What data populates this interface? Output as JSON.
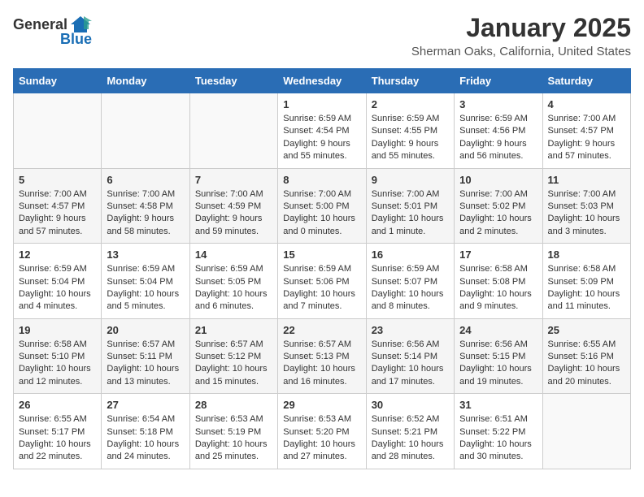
{
  "logo": {
    "general": "General",
    "blue": "Blue"
  },
  "header": {
    "title": "January 2025",
    "subtitle": "Sherman Oaks, California, United States"
  },
  "days_of_week": [
    "Sunday",
    "Monday",
    "Tuesday",
    "Wednesday",
    "Thursday",
    "Friday",
    "Saturday"
  ],
  "weeks": [
    [
      {
        "day": "",
        "sunrise": "",
        "sunset": "",
        "daylight": ""
      },
      {
        "day": "",
        "sunrise": "",
        "sunset": "",
        "daylight": ""
      },
      {
        "day": "",
        "sunrise": "",
        "sunset": "",
        "daylight": ""
      },
      {
        "day": "1",
        "sunrise": "Sunrise: 6:59 AM",
        "sunset": "Sunset: 4:54 PM",
        "daylight": "Daylight: 9 hours and 55 minutes."
      },
      {
        "day": "2",
        "sunrise": "Sunrise: 6:59 AM",
        "sunset": "Sunset: 4:55 PM",
        "daylight": "Daylight: 9 hours and 55 minutes."
      },
      {
        "day": "3",
        "sunrise": "Sunrise: 6:59 AM",
        "sunset": "Sunset: 4:56 PM",
        "daylight": "Daylight: 9 hours and 56 minutes."
      },
      {
        "day": "4",
        "sunrise": "Sunrise: 7:00 AM",
        "sunset": "Sunset: 4:57 PM",
        "daylight": "Daylight: 9 hours and 57 minutes."
      }
    ],
    [
      {
        "day": "5",
        "sunrise": "Sunrise: 7:00 AM",
        "sunset": "Sunset: 4:57 PM",
        "daylight": "Daylight: 9 hours and 57 minutes."
      },
      {
        "day": "6",
        "sunrise": "Sunrise: 7:00 AM",
        "sunset": "Sunset: 4:58 PM",
        "daylight": "Daylight: 9 hours and 58 minutes."
      },
      {
        "day": "7",
        "sunrise": "Sunrise: 7:00 AM",
        "sunset": "Sunset: 4:59 PM",
        "daylight": "Daylight: 9 hours and 59 minutes."
      },
      {
        "day": "8",
        "sunrise": "Sunrise: 7:00 AM",
        "sunset": "Sunset: 5:00 PM",
        "daylight": "Daylight: 10 hours and 0 minutes."
      },
      {
        "day": "9",
        "sunrise": "Sunrise: 7:00 AM",
        "sunset": "Sunset: 5:01 PM",
        "daylight": "Daylight: 10 hours and 1 minute."
      },
      {
        "day": "10",
        "sunrise": "Sunrise: 7:00 AM",
        "sunset": "Sunset: 5:02 PM",
        "daylight": "Daylight: 10 hours and 2 minutes."
      },
      {
        "day": "11",
        "sunrise": "Sunrise: 7:00 AM",
        "sunset": "Sunset: 5:03 PM",
        "daylight": "Daylight: 10 hours and 3 minutes."
      }
    ],
    [
      {
        "day": "12",
        "sunrise": "Sunrise: 6:59 AM",
        "sunset": "Sunset: 5:04 PM",
        "daylight": "Daylight: 10 hours and 4 minutes."
      },
      {
        "day": "13",
        "sunrise": "Sunrise: 6:59 AM",
        "sunset": "Sunset: 5:04 PM",
        "daylight": "Daylight: 10 hours and 5 minutes."
      },
      {
        "day": "14",
        "sunrise": "Sunrise: 6:59 AM",
        "sunset": "Sunset: 5:05 PM",
        "daylight": "Daylight: 10 hours and 6 minutes."
      },
      {
        "day": "15",
        "sunrise": "Sunrise: 6:59 AM",
        "sunset": "Sunset: 5:06 PM",
        "daylight": "Daylight: 10 hours and 7 minutes."
      },
      {
        "day": "16",
        "sunrise": "Sunrise: 6:59 AM",
        "sunset": "Sunset: 5:07 PM",
        "daylight": "Daylight: 10 hours and 8 minutes."
      },
      {
        "day": "17",
        "sunrise": "Sunrise: 6:58 AM",
        "sunset": "Sunset: 5:08 PM",
        "daylight": "Daylight: 10 hours and 9 minutes."
      },
      {
        "day": "18",
        "sunrise": "Sunrise: 6:58 AM",
        "sunset": "Sunset: 5:09 PM",
        "daylight": "Daylight: 10 hours and 11 minutes."
      }
    ],
    [
      {
        "day": "19",
        "sunrise": "Sunrise: 6:58 AM",
        "sunset": "Sunset: 5:10 PM",
        "daylight": "Daylight: 10 hours and 12 minutes."
      },
      {
        "day": "20",
        "sunrise": "Sunrise: 6:57 AM",
        "sunset": "Sunset: 5:11 PM",
        "daylight": "Daylight: 10 hours and 13 minutes."
      },
      {
        "day": "21",
        "sunrise": "Sunrise: 6:57 AM",
        "sunset": "Sunset: 5:12 PM",
        "daylight": "Daylight: 10 hours and 15 minutes."
      },
      {
        "day": "22",
        "sunrise": "Sunrise: 6:57 AM",
        "sunset": "Sunset: 5:13 PM",
        "daylight": "Daylight: 10 hours and 16 minutes."
      },
      {
        "day": "23",
        "sunrise": "Sunrise: 6:56 AM",
        "sunset": "Sunset: 5:14 PM",
        "daylight": "Daylight: 10 hours and 17 minutes."
      },
      {
        "day": "24",
        "sunrise": "Sunrise: 6:56 AM",
        "sunset": "Sunset: 5:15 PM",
        "daylight": "Daylight: 10 hours and 19 minutes."
      },
      {
        "day": "25",
        "sunrise": "Sunrise: 6:55 AM",
        "sunset": "Sunset: 5:16 PM",
        "daylight": "Daylight: 10 hours and 20 minutes."
      }
    ],
    [
      {
        "day": "26",
        "sunrise": "Sunrise: 6:55 AM",
        "sunset": "Sunset: 5:17 PM",
        "daylight": "Daylight: 10 hours and 22 minutes."
      },
      {
        "day": "27",
        "sunrise": "Sunrise: 6:54 AM",
        "sunset": "Sunset: 5:18 PM",
        "daylight": "Daylight: 10 hours and 24 minutes."
      },
      {
        "day": "28",
        "sunrise": "Sunrise: 6:53 AM",
        "sunset": "Sunset: 5:19 PM",
        "daylight": "Daylight: 10 hours and 25 minutes."
      },
      {
        "day": "29",
        "sunrise": "Sunrise: 6:53 AM",
        "sunset": "Sunset: 5:20 PM",
        "daylight": "Daylight: 10 hours and 27 minutes."
      },
      {
        "day": "30",
        "sunrise": "Sunrise: 6:52 AM",
        "sunset": "Sunset: 5:21 PM",
        "daylight": "Daylight: 10 hours and 28 minutes."
      },
      {
        "day": "31",
        "sunrise": "Sunrise: 6:51 AM",
        "sunset": "Sunset: 5:22 PM",
        "daylight": "Daylight: 10 hours and 30 minutes."
      },
      {
        "day": "",
        "sunrise": "",
        "sunset": "",
        "daylight": ""
      }
    ]
  ]
}
